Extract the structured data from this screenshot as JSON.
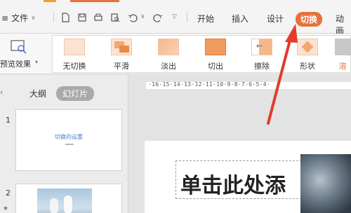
{
  "menu": {
    "file_label": "文件"
  },
  "tabs": [
    "开始",
    "插入",
    "设计",
    "切换",
    "动画"
  ],
  "active_tab_index": 3,
  "ribbon": {
    "preview_label": "预览效果",
    "effects": [
      "无切换",
      "平滑",
      "淡出",
      "切出",
      "擦除",
      "形状",
      "溶"
    ]
  },
  "left_panel": {
    "tabs": [
      "大纲",
      "幻灯片"
    ],
    "active_tab": "幻灯片",
    "slides": [
      {
        "number": "1",
        "title": "切换的设置"
      },
      {
        "number": "2"
      }
    ]
  },
  "ruler": {
    "labels": "·16·15·14·13·12·11·10·9·8·7·6·5·4·"
  },
  "editor": {
    "title_placeholder": "单击此处添"
  },
  "colors": {
    "accent": "#e8703a",
    "highlight_arrow": "#e23b2a",
    "link_blue": "#4a7ec9"
  }
}
